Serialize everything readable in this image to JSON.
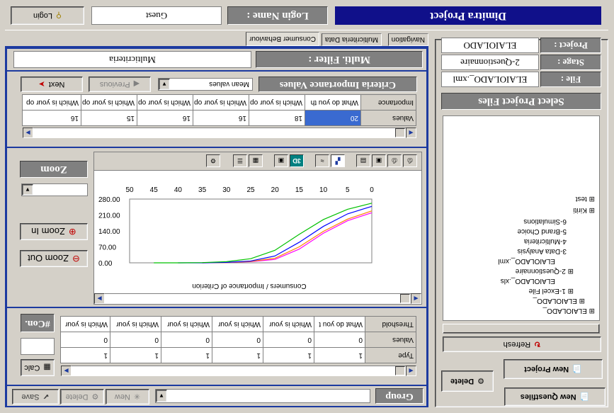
{
  "left_panel": {
    "new_questfiles_label": "New Questfiles",
    "new_project_label": "New Project",
    "delete_label": "Delete",
    "refresh_label": "Refresh",
    "tree": [
      "ELAIOLADO_",
      "ELAIOLADO_",
      "1-Excel File",
      "ELAIOLADO_.xls",
      "2-Questionnaire",
      "ELAIOLADO_.xml",
      "3-Data Analysis",
      "4-Multicriteria",
      "5-Brand Choice",
      "6-Simulations",
      "Kiriti",
      "test"
    ],
    "select_project_files_label": "Select Project Files",
    "file_label": "File :",
    "file_value": "ELAIOLADO_.xml",
    "stage_label": "Stage :",
    "stage_value": "2-Questionnaire",
    "project_label": "Project :",
    "project_value": "ELAIOLADO"
  },
  "top_bar": {
    "group_label": "Group",
    "group_value": "",
    "new_label": "New",
    "delete_label": "Delete",
    "save_label": "Save"
  },
  "calc": {
    "calc_label": "Calc",
    "calc_value": "",
    "con_label": "#Con."
  },
  "criteria_table": {
    "row_labels": [
      "Type",
      "Values",
      "Threshold"
    ],
    "type_values": [
      "1",
      "1",
      "1",
      "1",
      "1",
      "1"
    ],
    "values_values": [
      "0",
      "0",
      "0",
      "0",
      "0",
      "0"
    ],
    "threshold_values": [
      "What do you t",
      "Which is your",
      "Which is your",
      "Which is your",
      "Which is your",
      "Which is your"
    ]
  },
  "chart_data": {
    "type": "line",
    "x_ticks": [
      "0",
      "5",
      "10",
      "15",
      "20",
      "25",
      "30",
      "35",
      "40",
      "45",
      "50"
    ],
    "y_ticks": [
      "0.00",
      "70.00",
      "140.00",
      "210.00",
      "280.00"
    ],
    "xlabel": "Consumers / Importance of Criterion",
    "xlim": [
      0,
      50
    ],
    "ylim": [
      0,
      280
    ],
    "series": [
      {
        "color": "#ff00ff",
        "x": [
          0,
          5,
          10,
          15,
          20,
          25,
          30,
          35
        ],
        "y": [
          220,
          185,
          130,
          60,
          15,
          5,
          1,
          0
        ]
      },
      {
        "color": "#ff8000",
        "x": [
          0,
          5,
          10,
          15,
          20,
          25,
          30,
          35
        ],
        "y": [
          228,
          192,
          138,
          70,
          20,
          6,
          1,
          0
        ]
      },
      {
        "color": "#0000ff",
        "x": [
          0,
          5,
          10,
          15,
          20,
          25,
          30,
          35,
          40
        ],
        "y": [
          248,
          215,
          160,
          90,
          30,
          8,
          2,
          0,
          0
        ]
      },
      {
        "color": "#00c000",
        "x": [
          0,
          5,
          10,
          15,
          20,
          25,
          30,
          35,
          40,
          45
        ],
        "y": [
          262,
          235,
          190,
          125,
          55,
          18,
          5,
          1,
          0,
          0
        ]
      }
    ]
  },
  "zoom": {
    "zoom_out_label": "Zoom Out",
    "zoom_in_label": "Zoom In",
    "zoom_value": "",
    "zoom_button_label": "Zoom"
  },
  "importance_table": {
    "row_labels": [
      "Values",
      "Importance"
    ],
    "values": [
      "20",
      "18",
      "16",
      "16",
      "15",
      "16"
    ],
    "importance": [
      "What do you th",
      "Which is your op",
      "Which is your op",
      "Which is your op",
      "Which is your op",
      "Which is your op"
    ]
  },
  "criteria_controls": {
    "title": "Criteria Importance Values",
    "mode_value": "Mean values",
    "previous_label": "Previous",
    "next_label": "Next"
  },
  "multi_filter": {
    "label": "Multi. Filter :",
    "value": "Multicriteria"
  },
  "tabs": [
    "Navigation",
    "Multicriteria Data",
    "Consumer Behaviour"
  ],
  "footer": {
    "title": "Dimitra Project",
    "login_name_label": "Login Name :",
    "login_value": "Guest",
    "login_button_label": "Login"
  },
  "colors": {
    "accent": "#1c3aa0",
    "title_bar": "#10108a",
    "selection": "#3a6ad0"
  }
}
